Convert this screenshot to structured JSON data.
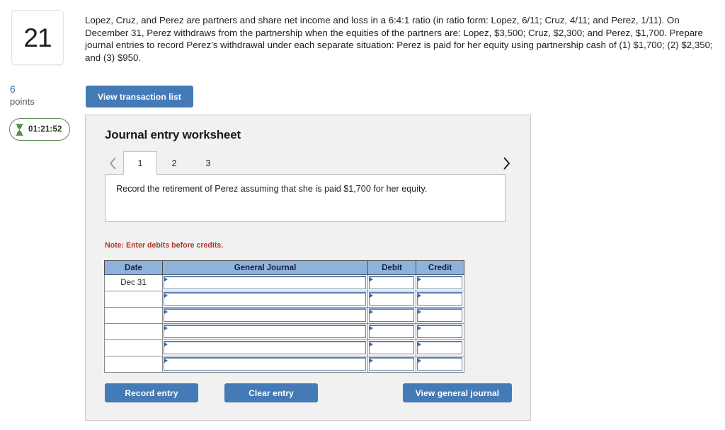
{
  "question": {
    "number": "21",
    "points_value": "6",
    "points_label": "points",
    "timer": "01:21:52",
    "timer_icon": "hourglass-icon",
    "text": "Lopez, Cruz, and Perez are partners and share net income and loss in a 6:4:1 ratio (in ratio form: Lopez, 6/11; Cruz, 4/11; and Perez, 1/11). On December 31, Perez withdraws from the partnership when the equities of the partners are: Lopez, $3,500; Cruz, $2,300; and Perez, $1,700. Prepare journal entries to record Perez’s withdrawal under each separate situation: Perez is paid for her equity using partnership cash of (1) $1,700; (2) $2,350; and (3) $950."
  },
  "toolbar": {
    "view_transaction_list_label": "View transaction list"
  },
  "worksheet": {
    "title": "Journal entry worksheet",
    "prev_icon": "chevron-left-icon",
    "next_icon": "chevron-right-icon",
    "tabs": [
      {
        "label": "1",
        "active": true
      },
      {
        "label": "2",
        "active": false
      },
      {
        "label": "3",
        "active": false
      }
    ],
    "active_tab_description": "Record the retirement of Perez assuming that she is paid $1,700 for her equity.",
    "note": "Note: Enter debits before credits.",
    "table": {
      "columns": [
        "Date",
        "General Journal",
        "Debit",
        "Credit"
      ],
      "rows": [
        {
          "date": "Dec 31",
          "general_journal": "",
          "debit": "",
          "credit": ""
        },
        {
          "date": "",
          "general_journal": "",
          "debit": "",
          "credit": ""
        },
        {
          "date": "",
          "general_journal": "",
          "debit": "",
          "credit": ""
        },
        {
          "date": "",
          "general_journal": "",
          "debit": "",
          "credit": ""
        },
        {
          "date": "",
          "general_journal": "",
          "debit": "",
          "credit": ""
        },
        {
          "date": "",
          "general_journal": "",
          "debit": "",
          "credit": ""
        }
      ]
    },
    "buttons": {
      "record_entry": "Record entry",
      "clear_entry": "Clear entry",
      "view_general_journal": "View general journal"
    }
  },
  "colors": {
    "button_blue": "#447ab5",
    "table_header_blue": "#8fb2dd",
    "field_border_blue": "#5782b8",
    "note_red": "#b5342b",
    "timer_green": "#5b8c52",
    "points_blue": "#3a6ea5",
    "panel_gray": "#f1f1f1"
  }
}
